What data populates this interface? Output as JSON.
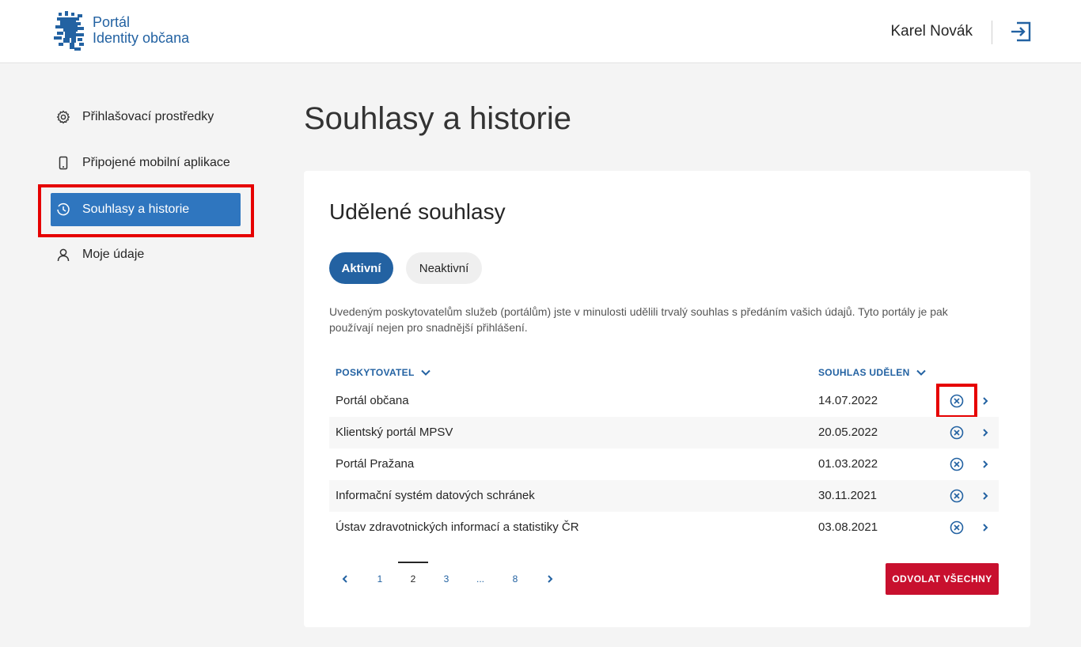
{
  "header": {
    "logo_line1": "Portál",
    "logo_line2": "Identity občana",
    "user_name": "Karel Novák",
    "logout_icon": "logout-icon"
  },
  "sidebar": {
    "items": [
      {
        "label": "Přihlašovací prostředky",
        "icon": "gear-icon",
        "active": false
      },
      {
        "label": "Připojené mobilní aplikace",
        "icon": "phone-icon",
        "active": false
      },
      {
        "label": "Souhlasy a historie",
        "icon": "clock-icon",
        "active": true
      },
      {
        "label": "Moje údaje",
        "icon": "person-icon",
        "active": false
      }
    ]
  },
  "main": {
    "title": "Souhlasy a historie",
    "card": {
      "title": "Udělené souhlasy",
      "tabs": [
        {
          "label": "Aktivní",
          "active": true
        },
        {
          "label": "Neaktivní",
          "active": false
        }
      ],
      "description": "Uvedeným poskytovatelům služeb (portálům) jste v minulosti udělili trvalý souhlas s předáním vašich údajů. Tyto portály je pak používají nejen pro snadnější přihlášení.",
      "columns": {
        "provider": "POSKYTOVATEL",
        "granted": "SOUHLAS UDĚLEN"
      },
      "rows": [
        {
          "provider": "Portál občana",
          "date": "14.07.2022"
        },
        {
          "provider": "Klientský portál MPSV",
          "date": "20.05.2022"
        },
        {
          "provider": "Portál Pražana",
          "date": "01.03.2022"
        },
        {
          "provider": "Informační systém datových schránek",
          "date": "30.11.2021"
        },
        {
          "provider": "Ústav zdravotnických informací a statistiky ČR",
          "date": "03.08.2021"
        }
      ],
      "pagination": {
        "pages": [
          "1",
          "2",
          "3",
          "...",
          "8"
        ],
        "current": "2"
      },
      "revoke_all_label": "ODVOLAT VŠECHNY"
    }
  },
  "colors": {
    "brand_blue": "#2362a2",
    "active_sidebar": "#2f76bf",
    "danger": "#c8102e",
    "highlight": "#e60000"
  }
}
